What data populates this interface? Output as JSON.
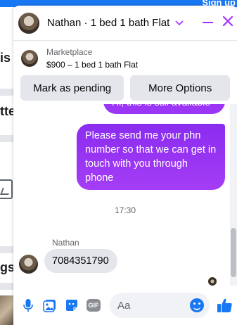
{
  "background": {
    "signup_label": "Sign up",
    "fragments": [
      "is",
      "tte",
      "gs"
    ]
  },
  "header": {
    "title": "Nathan · 1 bed 1 bath Flat"
  },
  "listing": {
    "label": "Marketplace",
    "title": "$900 – 1 bed 1 bath Flat"
  },
  "actions": {
    "pending_label": "Mark as pending",
    "more_label": "More Options"
  },
  "messages": {
    "prev_outgoing": "Hi, this is still available",
    "outgoing": "Please send me your phn number so that we can get in touch with you through phone",
    "time": "17:30",
    "sender": "Nathan",
    "incoming": "7084351790"
  },
  "composer": {
    "placeholder": "Aa",
    "gif_label": "GIF"
  },
  "colors": {
    "accent": "#a033ff",
    "bubble_out": "#9b36f5",
    "brand": "#1877f2"
  },
  "icons": [
    "microphone-icon",
    "image-icon",
    "sticker-icon",
    "gif-icon",
    "emoji-icon",
    "like-icon",
    "chevron-down-icon",
    "minimize-icon",
    "close-icon"
  ]
}
